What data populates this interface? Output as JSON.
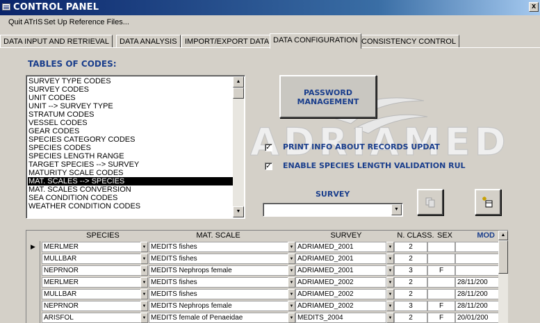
{
  "window": {
    "title": "CONTROL PANEL",
    "close_glyph": "x"
  },
  "menu": {
    "items": [
      "Quit ATrIS",
      "Set Up Reference Files..."
    ]
  },
  "tabs": [
    "DATA INPUT AND RETRIEVAL",
    "DATA ANALYSIS",
    "IMPORT/EXPORT DATA",
    "DATA CONFIGURATION",
    "CONSISTENCY CONTROL"
  ],
  "active_tab": "DATA CONFIGURATION",
  "codes": {
    "title": "TABLES OF CODES:",
    "items": [
      "SURVEY TYPE CODES",
      "SURVEY CODES",
      "UNIT CODES",
      "UNIT --> SURVEY TYPE",
      "STRATUM CODES",
      "VESSEL CODES",
      "GEAR CODES",
      "SPECIES CATEGORY CODES",
      "SPECIES CODES",
      "SPECIES LENGTH RANGE",
      "TARGET SPECIES --> SURVEY",
      "MATURITY SCALE CODES",
      "MAT. SCALES --> SPECIES",
      "MAT. SCALES CONVERSION",
      "SEA CONDITION CODES",
      "WEATHER CONDITION CODES"
    ],
    "selected": "MAT. SCALES --> SPECIES"
  },
  "password_button": {
    "line1": "PASSWORD",
    "line2": "MANAGEMENT"
  },
  "logo_text": "ADRIAMED",
  "checkboxes": [
    {
      "label": "PRINT INFO ABOUT RECORDS UPDAT",
      "checked": true
    },
    {
      "label": "ENABLE SPECIES LENGTH VALIDATION RUL",
      "checked": true
    }
  ],
  "survey": {
    "label": "SURVEY",
    "value": ""
  },
  "grid": {
    "columns": [
      "SPECIES",
      "MAT. SCALE",
      "SURVEY",
      "N. CLASS.",
      "SEX",
      "MOD"
    ],
    "rows": [
      {
        "species": "MERLMER",
        "scale": "MEDITS fishes",
        "survey": "ADRIAMED_2001",
        "nclass": "2",
        "sex": "",
        "mod": "",
        "current": true
      },
      {
        "species": "MULLBAR",
        "scale": "MEDITS fishes",
        "survey": "ADRIAMED_2001",
        "nclass": "2",
        "sex": "",
        "mod": ""
      },
      {
        "species": "NEPRNOR",
        "scale": "MEDITS Nephrops female",
        "survey": "ADRIAMED_2001",
        "nclass": "3",
        "sex": "F",
        "mod": ""
      },
      {
        "species": "MERLMER",
        "scale": "MEDITS fishes",
        "survey": "ADRIAMED_2002",
        "nclass": "2",
        "sex": "",
        "mod": "28/11/200"
      },
      {
        "species": "MULLBAR",
        "scale": "MEDITS fishes",
        "survey": "ADRIAMED_2002",
        "nclass": "2",
        "sex": "",
        "mod": "28/11/200"
      },
      {
        "species": "NEPRNOR",
        "scale": "MEDITS Nephrops female",
        "survey": "ADRIAMED_2002",
        "nclass": "3",
        "sex": "F",
        "mod": "28/11/200"
      },
      {
        "species": "ARISFOL",
        "scale": "MEDITS female of Penaeidae",
        "survey": "MEDITS_2004",
        "nclass": "2",
        "sex": "F",
        "mod": "20/01/200"
      }
    ]
  },
  "colors": {
    "accent": "#1a3e8c",
    "title_bar": "#0a246a",
    "face": "#d4d0c8"
  }
}
